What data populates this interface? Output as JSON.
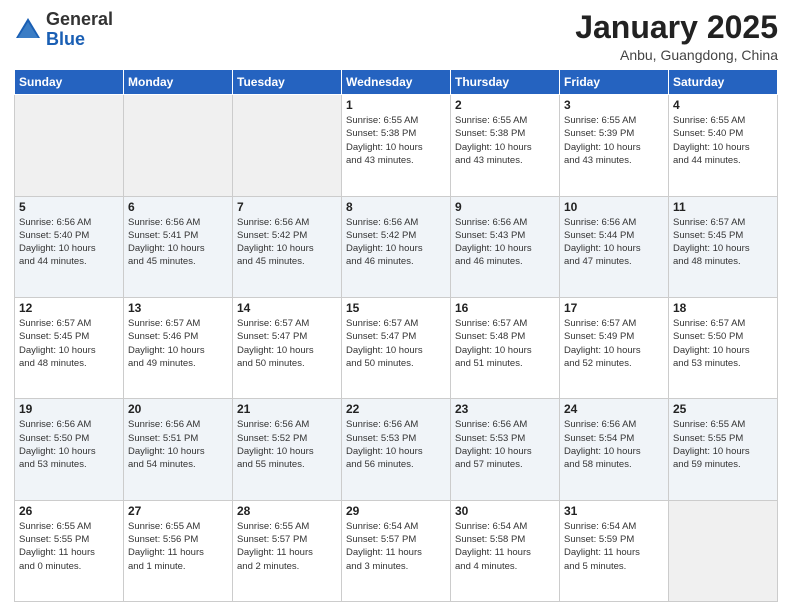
{
  "logo": {
    "general": "General",
    "blue": "Blue"
  },
  "header": {
    "title": "January 2025",
    "location": "Anbu, Guangdong, China"
  },
  "weekdays": [
    "Sunday",
    "Monday",
    "Tuesday",
    "Wednesday",
    "Thursday",
    "Friday",
    "Saturday"
  ],
  "weeks": [
    [
      {
        "day": "",
        "info": ""
      },
      {
        "day": "",
        "info": ""
      },
      {
        "day": "",
        "info": ""
      },
      {
        "day": "1",
        "info": "Sunrise: 6:55 AM\nSunset: 5:38 PM\nDaylight: 10 hours\nand 43 minutes."
      },
      {
        "day": "2",
        "info": "Sunrise: 6:55 AM\nSunset: 5:38 PM\nDaylight: 10 hours\nand 43 minutes."
      },
      {
        "day": "3",
        "info": "Sunrise: 6:55 AM\nSunset: 5:39 PM\nDaylight: 10 hours\nand 43 minutes."
      },
      {
        "day": "4",
        "info": "Sunrise: 6:55 AM\nSunset: 5:40 PM\nDaylight: 10 hours\nand 44 minutes."
      }
    ],
    [
      {
        "day": "5",
        "info": "Sunrise: 6:56 AM\nSunset: 5:40 PM\nDaylight: 10 hours\nand 44 minutes."
      },
      {
        "day": "6",
        "info": "Sunrise: 6:56 AM\nSunset: 5:41 PM\nDaylight: 10 hours\nand 45 minutes."
      },
      {
        "day": "7",
        "info": "Sunrise: 6:56 AM\nSunset: 5:42 PM\nDaylight: 10 hours\nand 45 minutes."
      },
      {
        "day": "8",
        "info": "Sunrise: 6:56 AM\nSunset: 5:42 PM\nDaylight: 10 hours\nand 46 minutes."
      },
      {
        "day": "9",
        "info": "Sunrise: 6:56 AM\nSunset: 5:43 PM\nDaylight: 10 hours\nand 46 minutes."
      },
      {
        "day": "10",
        "info": "Sunrise: 6:56 AM\nSunset: 5:44 PM\nDaylight: 10 hours\nand 47 minutes."
      },
      {
        "day": "11",
        "info": "Sunrise: 6:57 AM\nSunset: 5:45 PM\nDaylight: 10 hours\nand 48 minutes."
      }
    ],
    [
      {
        "day": "12",
        "info": "Sunrise: 6:57 AM\nSunset: 5:45 PM\nDaylight: 10 hours\nand 48 minutes."
      },
      {
        "day": "13",
        "info": "Sunrise: 6:57 AM\nSunset: 5:46 PM\nDaylight: 10 hours\nand 49 minutes."
      },
      {
        "day": "14",
        "info": "Sunrise: 6:57 AM\nSunset: 5:47 PM\nDaylight: 10 hours\nand 50 minutes."
      },
      {
        "day": "15",
        "info": "Sunrise: 6:57 AM\nSunset: 5:47 PM\nDaylight: 10 hours\nand 50 minutes."
      },
      {
        "day": "16",
        "info": "Sunrise: 6:57 AM\nSunset: 5:48 PM\nDaylight: 10 hours\nand 51 minutes."
      },
      {
        "day": "17",
        "info": "Sunrise: 6:57 AM\nSunset: 5:49 PM\nDaylight: 10 hours\nand 52 minutes."
      },
      {
        "day": "18",
        "info": "Sunrise: 6:57 AM\nSunset: 5:50 PM\nDaylight: 10 hours\nand 53 minutes."
      }
    ],
    [
      {
        "day": "19",
        "info": "Sunrise: 6:56 AM\nSunset: 5:50 PM\nDaylight: 10 hours\nand 53 minutes."
      },
      {
        "day": "20",
        "info": "Sunrise: 6:56 AM\nSunset: 5:51 PM\nDaylight: 10 hours\nand 54 minutes."
      },
      {
        "day": "21",
        "info": "Sunrise: 6:56 AM\nSunset: 5:52 PM\nDaylight: 10 hours\nand 55 minutes."
      },
      {
        "day": "22",
        "info": "Sunrise: 6:56 AM\nSunset: 5:53 PM\nDaylight: 10 hours\nand 56 minutes."
      },
      {
        "day": "23",
        "info": "Sunrise: 6:56 AM\nSunset: 5:53 PM\nDaylight: 10 hours\nand 57 minutes."
      },
      {
        "day": "24",
        "info": "Sunrise: 6:56 AM\nSunset: 5:54 PM\nDaylight: 10 hours\nand 58 minutes."
      },
      {
        "day": "25",
        "info": "Sunrise: 6:55 AM\nSunset: 5:55 PM\nDaylight: 10 hours\nand 59 minutes."
      }
    ],
    [
      {
        "day": "26",
        "info": "Sunrise: 6:55 AM\nSunset: 5:55 PM\nDaylight: 11 hours\nand 0 minutes."
      },
      {
        "day": "27",
        "info": "Sunrise: 6:55 AM\nSunset: 5:56 PM\nDaylight: 11 hours\nand 1 minute."
      },
      {
        "day": "28",
        "info": "Sunrise: 6:55 AM\nSunset: 5:57 PM\nDaylight: 11 hours\nand 2 minutes."
      },
      {
        "day": "29",
        "info": "Sunrise: 6:54 AM\nSunset: 5:57 PM\nDaylight: 11 hours\nand 3 minutes."
      },
      {
        "day": "30",
        "info": "Sunrise: 6:54 AM\nSunset: 5:58 PM\nDaylight: 11 hours\nand 4 minutes."
      },
      {
        "day": "31",
        "info": "Sunrise: 6:54 AM\nSunset: 5:59 PM\nDaylight: 11 hours\nand 5 minutes."
      },
      {
        "day": "",
        "info": ""
      }
    ]
  ]
}
